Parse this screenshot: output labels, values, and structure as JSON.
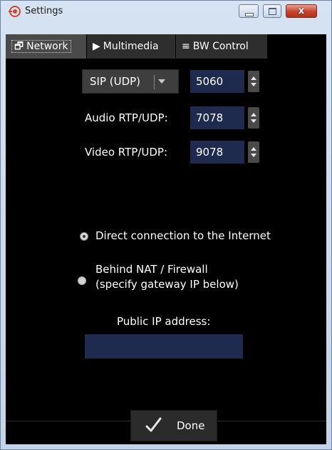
{
  "window": {
    "title": "Settings",
    "close_glyph": "x",
    "icon": "target-icon"
  },
  "tabs": [
    {
      "label": "Network",
      "icon": "window-icon",
      "glyph": "🗗",
      "active": true
    },
    {
      "label": "Multimedia",
      "icon": "play-icon",
      "glyph": "▶",
      "active": false
    },
    {
      "label": "BW Control",
      "icon": "menu-icon",
      "glyph": "≡",
      "active": false
    }
  ],
  "network": {
    "protocol": "SIP (UDP)",
    "sip_port": "5060",
    "audio_label": "Audio RTP/UDP:",
    "audio_port": "7078",
    "video_label": "Video RTP/UDP:",
    "video_port": "9078"
  },
  "connection": {
    "direct_label": "Direct connection to the Internet",
    "direct_selected": true,
    "nat_label_line1": "Behind NAT / Firewall",
    "nat_label_line2": "(specify gateway IP below)",
    "nat_selected": false
  },
  "public_ip": {
    "label": "Public IP address:",
    "value": ""
  },
  "footer": {
    "done_label": "Done"
  },
  "colors": {
    "field_bg": "#1e2a4e",
    "panel_bg": "#000000",
    "accent_close": "#c6422b"
  }
}
